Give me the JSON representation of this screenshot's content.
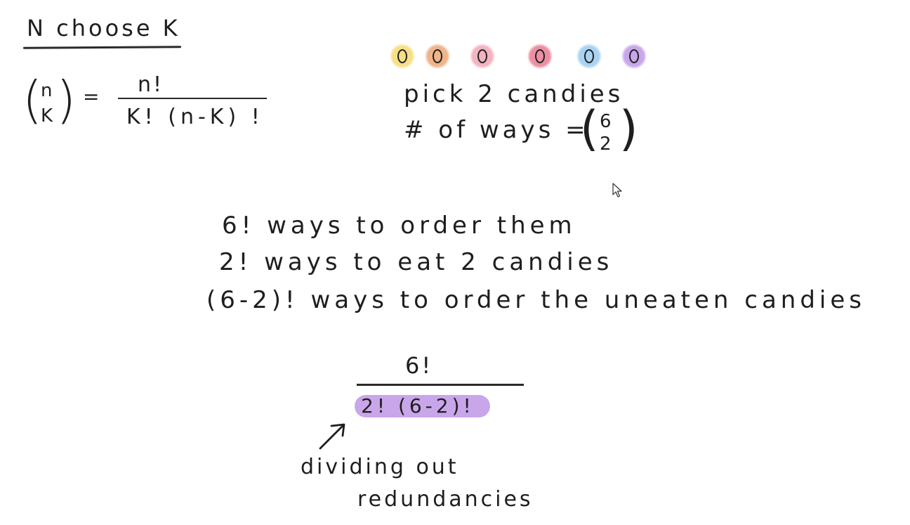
{
  "title": "N choose K",
  "formula": {
    "binom_top": "n",
    "binom_bottom": "K",
    "equals": "=",
    "numerator": "n!",
    "denominator": "K! (n-K) !"
  },
  "candies": [
    {
      "name": "yellow-candy",
      "color": "#f7df86"
    },
    {
      "name": "orange-candy",
      "color": "#efb48a"
    },
    {
      "name": "pink-candy",
      "color": "#f3b3c0"
    },
    {
      "name": "rose-candy",
      "color": "#ec8fa3"
    },
    {
      "name": "blue-candy",
      "color": "#a9d3f0"
    },
    {
      "name": "purple-candy",
      "color": "#c9a6ea"
    }
  ],
  "pick_text": "pick 2 candies",
  "ways": {
    "label": "# of ways =",
    "binom_top": "6",
    "binom_bottom": "2"
  },
  "statements": [
    "6! ways to order them",
    "2! ways to eat 2 candies",
    "(6-2)! ways to order the uneaten candies"
  ],
  "result": {
    "numerator": "6!",
    "denominator": "2! (6-2)!",
    "highlight_color": "#c9a6ea"
  },
  "annotation": {
    "line1": "dividing out",
    "line2": "redundancies"
  }
}
